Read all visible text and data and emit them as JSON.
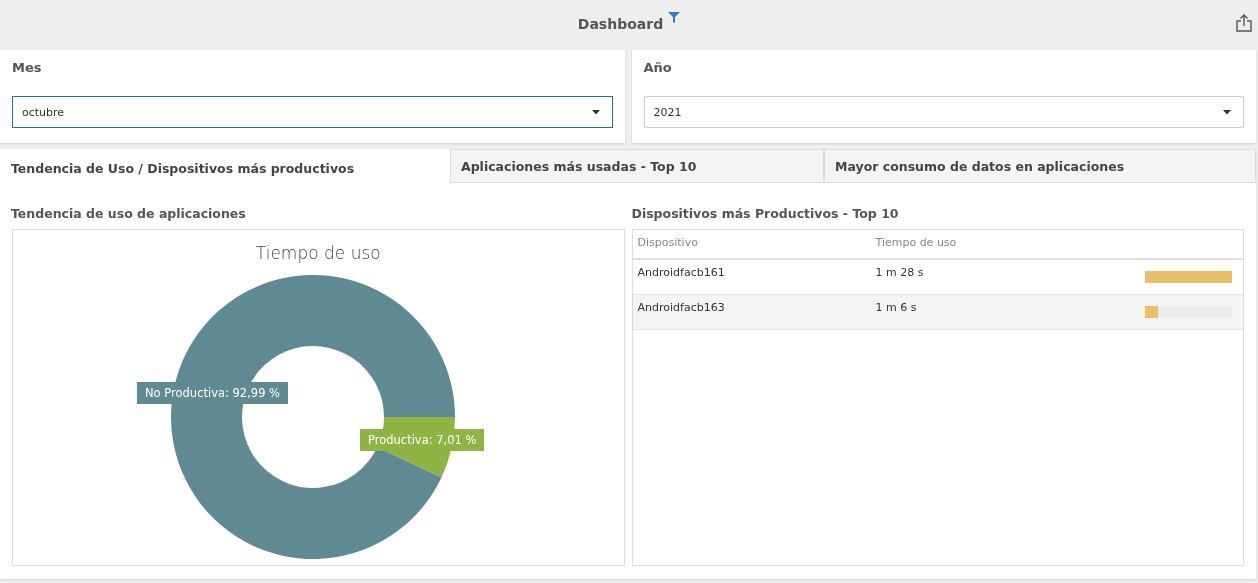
{
  "header": {
    "title": "Dashboard"
  },
  "filters": [
    {
      "label": "Mes",
      "value": "octubre",
      "focused": true
    },
    {
      "label": "Año",
      "value": "2021",
      "focused": false
    }
  ],
  "tabs": [
    {
      "label": "Tendencia de Uso / Dispositivos más productivos",
      "selected": true
    },
    {
      "label": "Aplicaciones más usadas - Top 10",
      "selected": false
    },
    {
      "label": "Mayor consumo de datos en aplicaciones",
      "selected": false
    }
  ],
  "usage_panel": {
    "heading": "Tendencia de uso de aplicaciones",
    "chart_data": {
      "type": "donut",
      "title": "Tiempo de uso",
      "values": [
        92.99,
        7.01
      ],
      "colors": [
        "#5f8a93",
        "#8fb444"
      ],
      "value_labels": [
        "No Productiva: 92,99 %",
        "Productiva: 7,01 %"
      ]
    }
  },
  "devices_panel": {
    "heading": "Dispositivos más Productivos - Top 10",
    "columns": [
      "Dispositivo",
      "Tiempo de uso"
    ],
    "rows": [
      {
        "device": "Androidfacb161",
        "time": "1 m 28 s",
        "level": 1.0
      },
      {
        "device": "Androidfacb163",
        "time": "1 m 6 s",
        "level": 0.15
      }
    ]
  }
}
